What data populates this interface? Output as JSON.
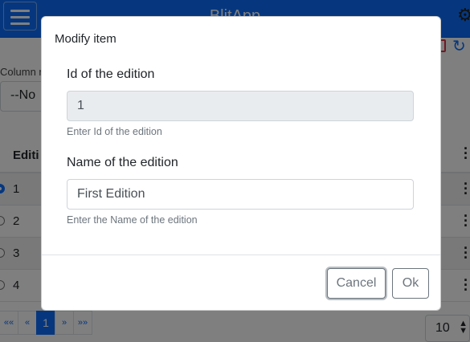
{
  "app": {
    "brand": "BlitApp"
  },
  "filter": {
    "column_label": "Column n",
    "select_value": "--No"
  },
  "table": {
    "header": "Editi",
    "rows": [
      {
        "id": "1",
        "selected": true
      },
      {
        "id": "2",
        "selected": false
      },
      {
        "id": "3",
        "selected": false
      },
      {
        "id": "4",
        "selected": false
      }
    ]
  },
  "pagination": {
    "first": "««",
    "prev": "«",
    "current": "1",
    "next": "»",
    "last": "»»",
    "page_size": "10"
  },
  "modal": {
    "title": "Modify item",
    "id_field": {
      "label": "Id of the edition",
      "value": "1",
      "help": "Enter Id of the edition"
    },
    "name_field": {
      "label": "Name of the edition",
      "value": "First Edition",
      "help": "Enter the Name of the edition"
    },
    "cancel_label": "Cancel",
    "ok_label": "Ok"
  },
  "colors": {
    "primary": "#0d6efd",
    "secondary": "#6c757d",
    "danger": "#dc3545"
  }
}
